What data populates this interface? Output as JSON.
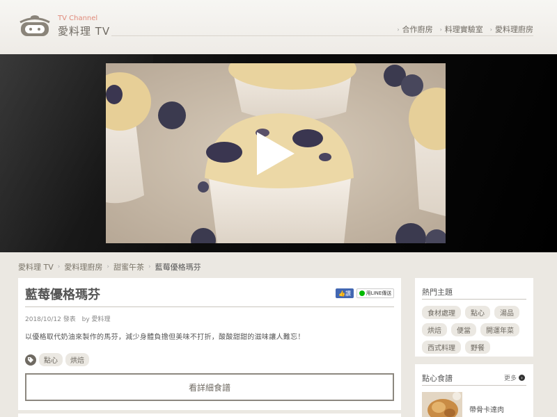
{
  "header": {
    "logo_sub": "TV Channel",
    "logo_title": "愛料理 TV",
    "nav": [
      "合作廚房",
      "料理實驗室",
      "愛料理廚房"
    ]
  },
  "video": {
    "play_icon": "play-icon"
  },
  "breadcrumb": [
    "愛料理 TV",
    "愛料理廚房",
    "甜蜜午茶",
    "藍莓優格瑪芬"
  ],
  "article": {
    "title": "藍莓優格瑪芬",
    "share_fb": "讚",
    "share_line": "用LINE傳送",
    "date": "2018/10/12 發表",
    "author": "by 愛料理",
    "description": "以優格取代奶油來製作的馬芬，減少身體負擔但美味不打折，酸酸甜甜的滋味讓人難忘！",
    "tags": [
      "點心",
      "烘焙"
    ],
    "recipe_button": "看詳細食譜"
  },
  "sidebar": {
    "hot_title": "熱門主題",
    "hot_topics": [
      "食材處理",
      "點心",
      "湯品",
      "烘焙",
      "便當",
      "開運年菜",
      "西式料理",
      "野餐"
    ],
    "snack_title": "點心食譜",
    "more": "更多",
    "snack_items": [
      "帶骨卡達肉"
    ]
  },
  "colors": {
    "background": "#ebe8e2",
    "accent": "#e08a7a",
    "fb": "#4267b2",
    "line": "#00b900"
  }
}
